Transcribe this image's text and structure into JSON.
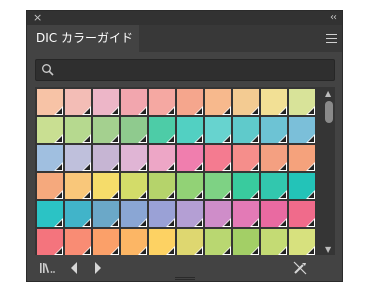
{
  "panel": {
    "tab_title": "DIC カラーガイド",
    "close_glyph": "×",
    "collapse_glyph": "‹‹"
  },
  "search": {
    "placeholder": "",
    "value": ""
  },
  "swatches": [
    "#f7c3a6",
    "#f3bdb6",
    "#edb6c8",
    "#f2a6ae",
    "#f5a8a2",
    "#f5a68d",
    "#f7b98d",
    "#f3cb92",
    "#f2e095",
    "#d8e399",
    "#c9df92",
    "#b6d98f",
    "#a4d08f",
    "#8fca8e",
    "#4dcca7",
    "#52d0c2",
    "#67d3cf",
    "#5fcacb",
    "#6dc3d4",
    "#7bbfd9",
    "#a0bfe0",
    "#bfc0dc",
    "#c6b5d3",
    "#e0b5d5",
    "#eda6c6",
    "#f07eae",
    "#f47b90",
    "#f58e8b",
    "#f4a081",
    "#f5a27c",
    "#f5a97d",
    "#f9c77a",
    "#f5dc6a",
    "#d3dc69",
    "#b5d36b",
    "#92d276",
    "#7ed284",
    "#39cb9e",
    "#32c7ae",
    "#23c3b8",
    "#2bc3c5",
    "#41b4c9",
    "#6ba8c8",
    "#8aa6d4",
    "#9aa1d6",
    "#b49fd4",
    "#cf8dc9",
    "#e37ab6",
    "#e96aa1",
    "#f06b8b",
    "#f4747d",
    "#f98c74",
    "#fba069",
    "#fcb665",
    "#fdd263",
    "#ded770",
    "#b9d771",
    "#a3cf66",
    "#c4db74",
    "#d7e17e"
  ],
  "bottom_icons": [
    "library-icon",
    "previous-arrow-icon",
    "next-arrow-icon",
    "no-edit-icon"
  ],
  "colors": {
    "panel_bg": "#434343",
    "title_bar": "#323232",
    "tab_strip": "#383838",
    "field_bg": "#2f2f2f"
  }
}
